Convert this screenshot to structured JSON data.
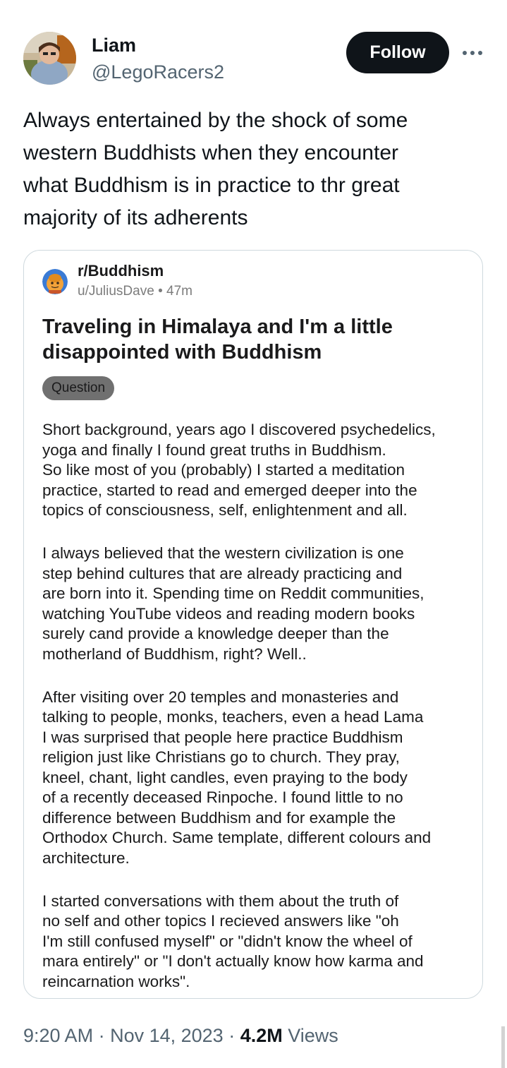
{
  "author": {
    "name": "Liam",
    "handle": "@LegoRacers2"
  },
  "follow_label": "Follow",
  "tweet_lines": [
    "Always entertained by the shock of some",
    "western Buddhists when they encounter",
    "what Buddhism is in practice to thr great",
    "majority of its adherents"
  ],
  "card": {
    "subreddit": "r/Buddhism",
    "user": "u/JuliusDave",
    "time": "47m",
    "title_lines": [
      "Traveling in Himalaya and I'm a little",
      "disappointed with Buddhism"
    ],
    "flair": "Question",
    "paragraphs": [
      [
        "Short background, years ago I discovered psychedelics,",
        "yoga and finally I found great truths in Buddhism.",
        "So like most of you (probably) I started a meditation",
        "practice, started to read and emerged deeper into the",
        "topics of consciousness, self, enlightenment and all."
      ],
      [
        "I always believed that the western civilization is one",
        "step behind cultures that are already practicing and",
        "are born into it. Spending time on Reddit communities,",
        "watching YouTube videos and reading modern books",
        "surely cand provide a knowledge deeper than the",
        "motherland of Buddhism, right? Well.."
      ],
      [
        "After visiting over 20 temples and monasteries and",
        "talking to people, monks, teachers, even a head Lama",
        "I was surprised that people here practice Buddhism",
        "religion just like Christians go to church. They pray,",
        "kneel,  chant,  light candles, even praying to the body",
        "of a recently deceased Rinpoche. I found little to no",
        "difference between Buddhism and for example the",
        "Orthodox Church. Same template, different colours and",
        "architecture."
      ],
      [
        "I started conversations with them about the truth of",
        "no self and other topics I recieved answers like \"oh",
        "I'm still confused myself\" or \"didn't know the wheel of",
        "mara entirely\" or \"I don't actually know how karma and",
        "reincarnation works\"."
      ]
    ]
  },
  "footer": {
    "time": "9:20 AM",
    "date": "Nov 14, 2023",
    "views_count": "4.2M",
    "views_label": "Views"
  },
  "icons": {
    "avatar": "profile-photo",
    "more": "more-horizontal-icon",
    "subreddit": "snoo-monk-icon"
  }
}
